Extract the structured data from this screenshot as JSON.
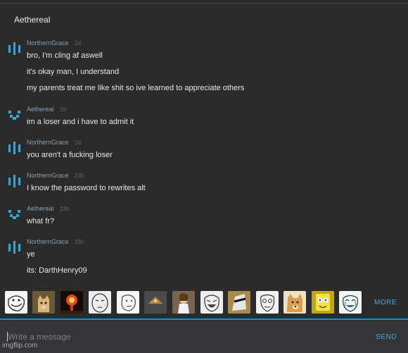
{
  "header": {
    "title": "Aethereal"
  },
  "messages": [
    {
      "user": "NorthernGrace",
      "time": "2d",
      "avatar": "bars-avatar-icon",
      "lines": [
        "bro, I'm cling af aswell",
        "it's okay man, I understand",
        "my parents treat me like shit so ive learned to appreciate others"
      ]
    },
    {
      "user": "Aethereal",
      "time": "2d",
      "avatar": "pixel-avatar-icon",
      "lines": [
        "im a loser and i have to admit it"
      ]
    },
    {
      "user": "NorthernGrace",
      "time": "2d",
      "avatar": "bars-avatar-icon",
      "lines": [
        "you aren't a fucking loser"
      ]
    },
    {
      "user": "NorthernGrace",
      "time": "23h",
      "avatar": "bars-avatar-icon",
      "lines": [
        "I know the password to rewrites alt"
      ]
    },
    {
      "user": "Aethereal",
      "time": "23h",
      "avatar": "pixel-avatar-icon",
      "lines": [
        "what fr?"
      ]
    },
    {
      "user": "NorthernGrace",
      "time": "23h",
      "avatar": "bars-avatar-icon",
      "lines": [
        "ye",
        "its: DarthHenry09"
      ]
    }
  ],
  "tray": {
    "more_label": "MORE",
    "meme_icons": [
      "troll-face-icon",
      "cat-icon",
      "explosion-icon",
      "okay-face-icon",
      "thinking-face-icon",
      "illuminati-icon",
      "jesus-thumbs-icon",
      "laughing-face-icon",
      "cool-face-icon",
      "me-gusta-icon",
      "doge-icon",
      "spongebob-icon",
      "happy-cry-icon"
    ]
  },
  "input": {
    "placeholder": "Write a message",
    "send_label": "SEND"
  },
  "watermark": "imgflip.com",
  "colors": {
    "accent": "#1f8fc7",
    "link": "#4aaad6",
    "avatar": "#36a6d6",
    "background": "#2b2b2b"
  }
}
